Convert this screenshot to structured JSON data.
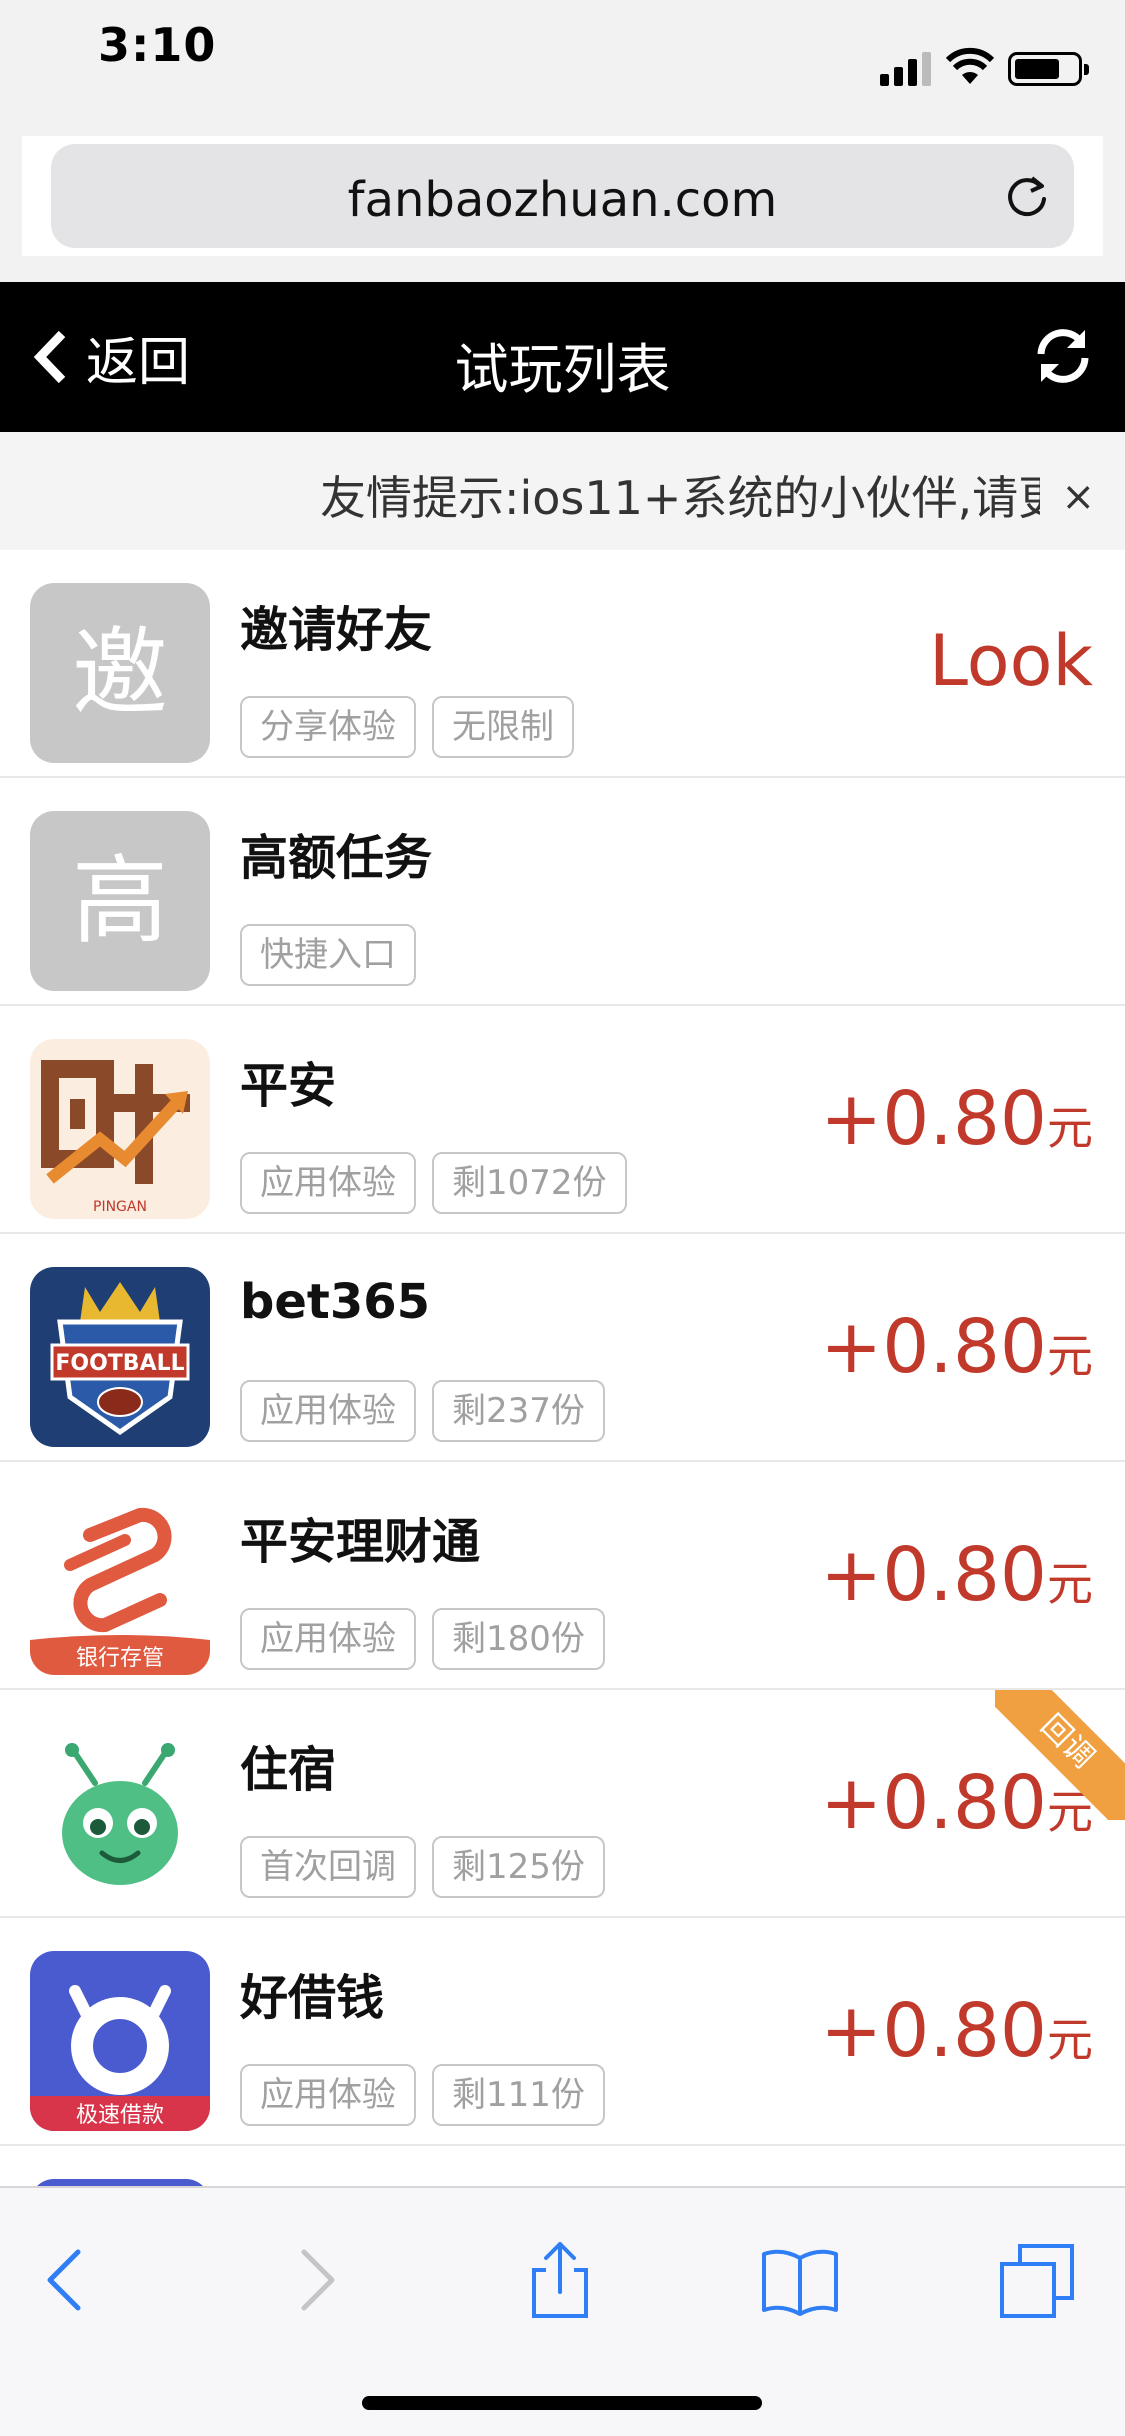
{
  "status": {
    "time": "3:10"
  },
  "browser": {
    "url": "fanbaozhuan.com"
  },
  "nav": {
    "back_label": "返回",
    "title": "试玩列表"
  },
  "notice": {
    "text": "友情提示:ios11+系统的小伙伴,请更",
    "close": "×"
  },
  "tasks": [
    {
      "name": "邀请好友",
      "icon_letter": "邀",
      "tags": [
        "分享体验",
        "无限制"
      ],
      "action": "Look"
    },
    {
      "name": "高额任务",
      "icon_letter": "高",
      "tags": [
        "快捷入口"
      ]
    },
    {
      "name": "平安",
      "icon": "caifu-app-icon",
      "tags": [
        "应用体验",
        "剩1072份"
      ],
      "reward": "+0.80",
      "unit": "元"
    },
    {
      "name": "bet365",
      "icon": "football-app-icon",
      "tags": [
        "应用体验",
        "剩237份"
      ],
      "reward": "+0.80",
      "unit": "元"
    },
    {
      "name": "平安理财通",
      "icon": "bank-deposit-app-icon",
      "tags": [
        "应用体验",
        "剩180份"
      ],
      "reward": "+0.80",
      "unit": "元"
    },
    {
      "name": "住宿",
      "icon": "green-bug-app-icon",
      "tags": [
        "首次回调",
        "剩125份"
      ],
      "reward": "+0.80",
      "unit": "元",
      "ribbon": "回调"
    },
    {
      "name": "好借钱",
      "icon": "loan-app-icon",
      "tags": [
        "应用体验",
        "剩111份"
      ],
      "reward": "+0.80",
      "unit": "元",
      "icon_caption": "极速借款"
    }
  ],
  "colors": {
    "accent": "#c0392b",
    "nav_bg": "#000000",
    "ribbon": "#f0a040"
  }
}
